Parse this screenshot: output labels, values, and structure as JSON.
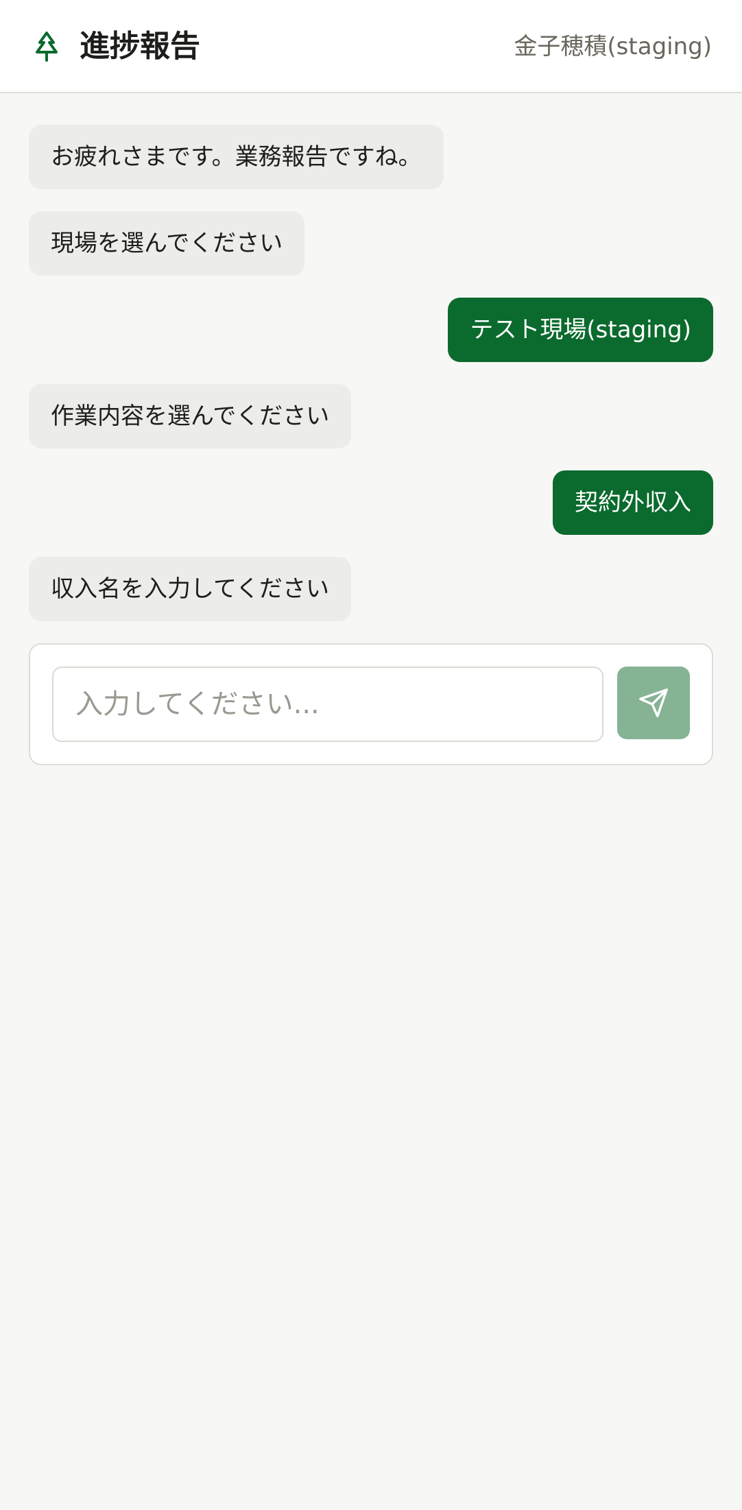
{
  "header": {
    "title": "進捗報告",
    "user": "金子穂積(staging)",
    "logo_icon": "tree-icon"
  },
  "messages": [
    {
      "role": "bot",
      "text": "お疲れさまです。業務報告ですね。"
    },
    {
      "role": "bot",
      "text": "現場を選んでください"
    },
    {
      "role": "user",
      "text": "テスト現場(staging)"
    },
    {
      "role": "bot",
      "text": "作業内容を選んでください"
    },
    {
      "role": "user",
      "text": "契約外収入"
    },
    {
      "role": "bot",
      "text": "収入名を入力してください"
    }
  ],
  "composer": {
    "value": "",
    "placeholder": "入力してください...",
    "send_icon": "send-icon"
  },
  "colors": {
    "accent": "#0b6a2d",
    "send_button": "#85b394",
    "bot_bubble": "#ecede9",
    "background": "#f7f8f6"
  }
}
